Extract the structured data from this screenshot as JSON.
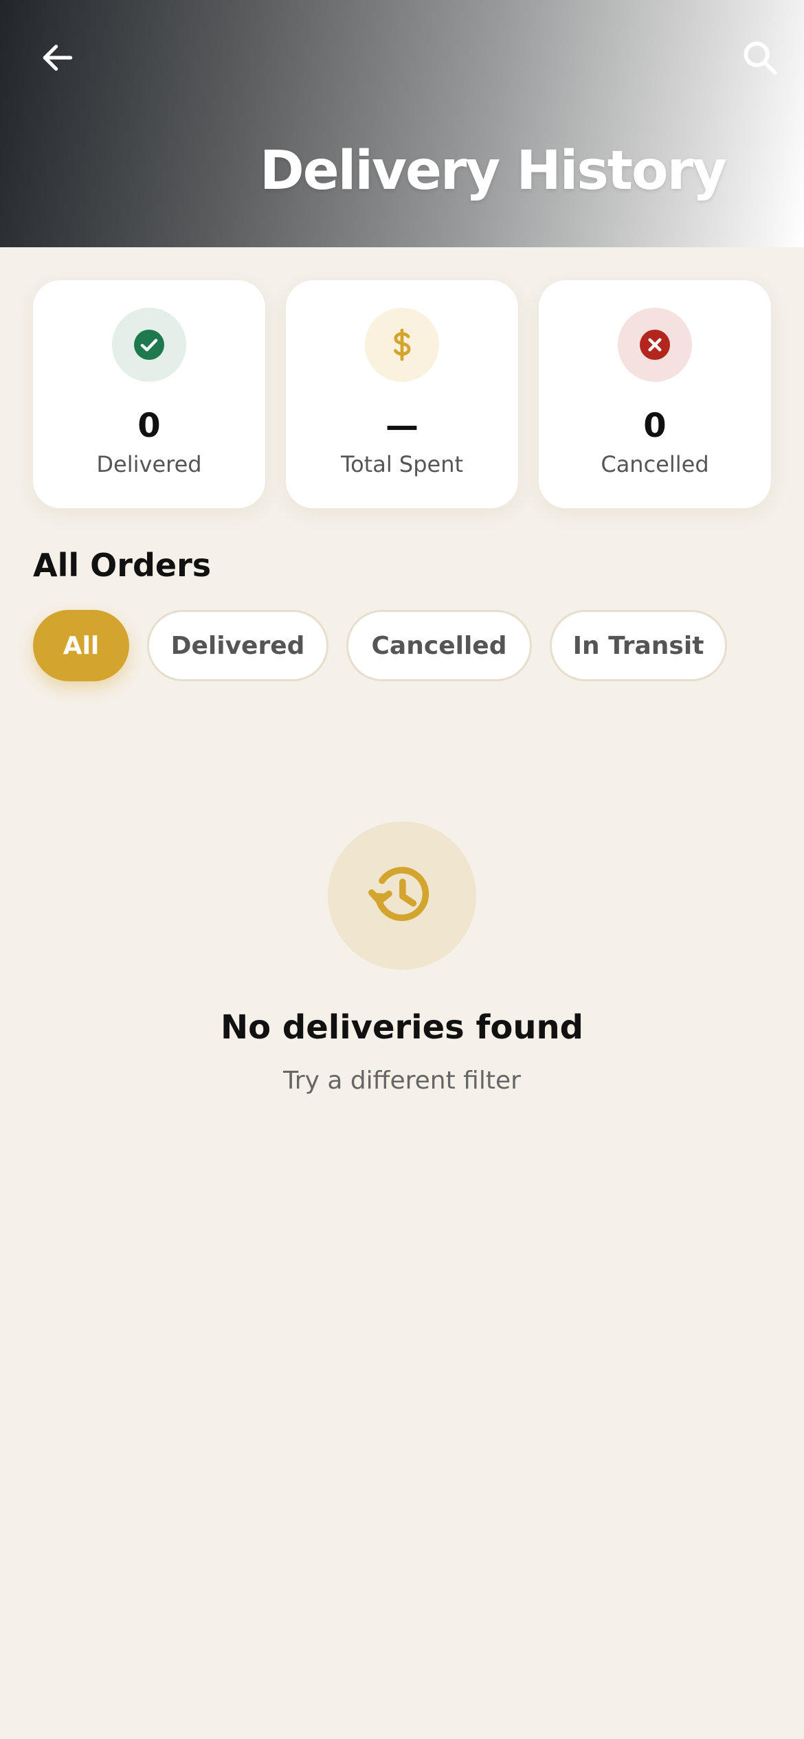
{
  "header": {
    "title": "Delivery History"
  },
  "stats": [
    {
      "value": "0",
      "label": "Delivered",
      "icon": "check-icon",
      "icon_color": "#1E7A4E",
      "icon_bg": "#E3EFE8"
    },
    {
      "value": "—",
      "label": "Total Spent",
      "icon": "dollar-icon",
      "icon_color": "#D4A52E",
      "icon_bg": "#FAF1DE"
    },
    {
      "value": "0",
      "label": "Cancelled",
      "icon": "close-icon",
      "icon_color": "#B3261E",
      "icon_bg": "#F6E1E1"
    }
  ],
  "orders": {
    "section_title": "All Orders",
    "filters": [
      "All",
      "Delivered",
      "Cancelled",
      "In Transit"
    ],
    "active_filter": "All"
  },
  "empty_state": {
    "icon": "history-icon",
    "title": "No deliveries found",
    "subtitle": "Try a different filter"
  },
  "colors": {
    "accent": "#D4A52E",
    "background": "#F5F0E8",
    "success": "#1E7A4E",
    "danger": "#B3261E"
  }
}
